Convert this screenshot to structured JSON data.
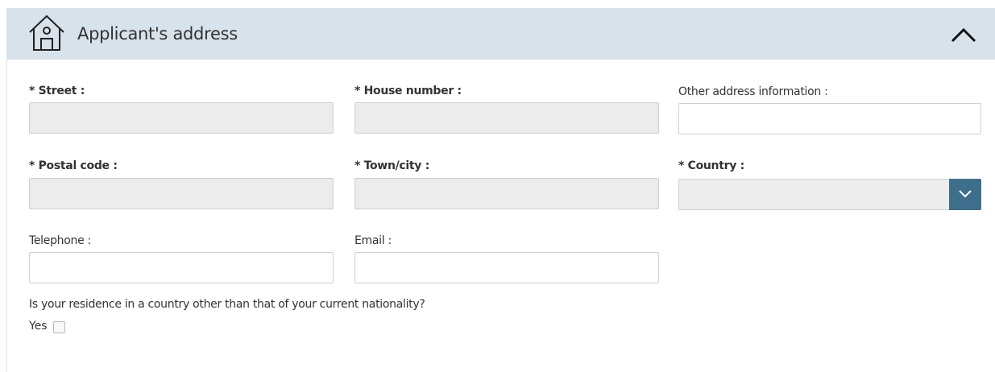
{
  "header": {
    "title": "Applicant's address",
    "icon": "home-icon",
    "toggle_icon": "chevron-up-icon"
  },
  "fields": {
    "street": {
      "label": "* Street :",
      "value": ""
    },
    "house_number": {
      "label": "* House number :",
      "value": ""
    },
    "other_info": {
      "label": "Other address information :",
      "value": ""
    },
    "postal_code": {
      "label": "* Postal code :",
      "value": ""
    },
    "town_city": {
      "label": "* Town/city :",
      "value": ""
    },
    "country": {
      "label": "* Country :",
      "value": "",
      "icon": "chevron-down-icon"
    },
    "telephone": {
      "label": "Telephone :",
      "value": ""
    },
    "email": {
      "label": "Email :",
      "value": ""
    }
  },
  "residence": {
    "question": "Is your residence in a country other than that of your current nationality?",
    "yes_label": "Yes",
    "checked": false
  },
  "colors": {
    "header_bg": "#d7e2ea",
    "disabled_bg": "#ececec",
    "select_button": "#3d6f8d"
  }
}
